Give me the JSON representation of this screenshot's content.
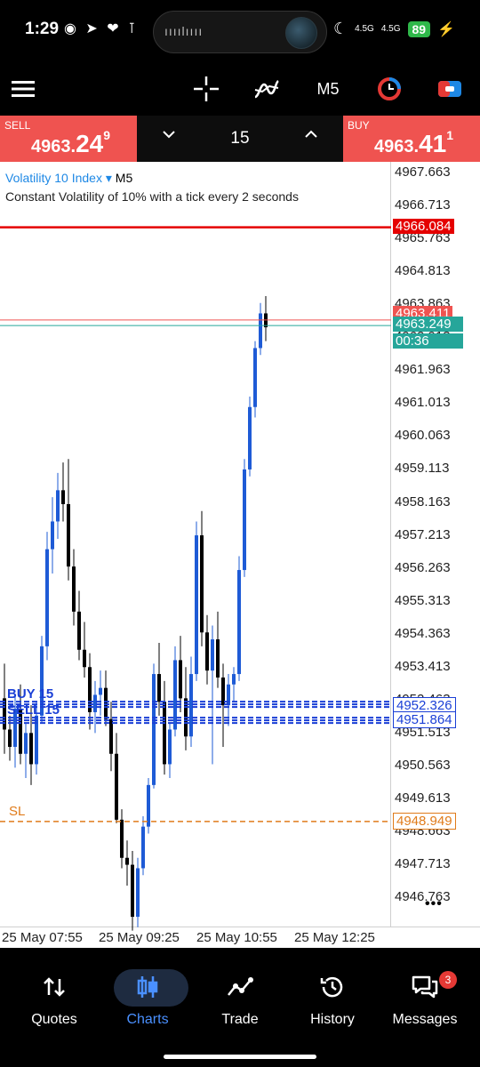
{
  "status_bar": {
    "time": "1:29",
    "left_icons": "◉ ➤ ❤ ⊺",
    "network1": "4.5G",
    "network2": "4.5G",
    "battery": "89",
    "wave": "ıııılıııı"
  },
  "toolbar": {
    "timeframe": "M5"
  },
  "quote": {
    "sell_label": "SELL",
    "sell_price_small": "4963.",
    "sell_price_big": "24",
    "sell_price_sup": "9",
    "buy_label": "BUY",
    "buy_price_small": "4963.",
    "buy_price_big": "41",
    "buy_price_sup": "1",
    "lot": "15"
  },
  "chart": {
    "symbol": "Volatility 10 Index",
    "timeframe": "M5",
    "description": "Constant Volatility of 10% with a tick every 2 seconds",
    "sl_label": "SL",
    "buy_line_label": "BUY 15",
    "sell_line_label": "SELL 15",
    "more": "•••"
  },
  "chart_data": {
    "type": "candlestick",
    "y_ticks": [
      "4967.663",
      "4966.713",
      "4965.763",
      "4964.813",
      "4963.863",
      "4962.913",
      "4961.963",
      "4961.013",
      "4960.063",
      "4959.113",
      "4958.163",
      "4957.213",
      "4956.263",
      "4955.313",
      "4954.363",
      "4953.413",
      "4952.463",
      "4951.513",
      "4950.563",
      "4949.613",
      "4948.663",
      "4947.713",
      "4946.763"
    ],
    "x_ticks": [
      "25 May 07:55",
      "25 May 09:25",
      "25 May 10:55",
      "25 May 12:25"
    ],
    "ylim": [
      4946.2,
      4968.1
    ],
    "price_tags": {
      "alert": "4966.084",
      "ask": "4963.411",
      "bid": "4963.249",
      "countdown": "00:36",
      "buy_position": "4952.326",
      "sell_position": "4951.864",
      "stop_loss": "4948.949"
    },
    "colors": {
      "bull": "#1e5bd6",
      "bear": "#000000",
      "alert": "#e50000",
      "sl": "#e07b1a",
      "position": "#1a3fd6",
      "bid": "#26a69a",
      "ask": "#ef5350"
    },
    "candles": [
      [
        4952.5,
        4953.5,
        4950.9,
        4951.6
      ],
      [
        4951.6,
        4952.0,
        4950.7,
        4951.1
      ],
      [
        4951.1,
        4952.6,
        4950.5,
        4952.2
      ],
      [
        4952.2,
        4952.9,
        4950.6,
        4950.9
      ],
      [
        4950.9,
        4951.8,
        4950.2,
        4951.5
      ],
      [
        4951.5,
        4952.3,
        4950.0,
        4950.6
      ],
      [
        4950.6,
        4952.4,
        4950.3,
        4952.0
      ],
      [
        4952.0,
        4954.3,
        4951.8,
        4954.0
      ],
      [
        4954.0,
        4957.3,
        4953.6,
        4956.8
      ],
      [
        4956.8,
        4958.3,
        4956.1,
        4957.6
      ],
      [
        4957.6,
        4959.0,
        4957.1,
        4958.5
      ],
      [
        4958.5,
        4959.3,
        4957.6,
        4958.1
      ],
      [
        4958.1,
        4959.4,
        4955.9,
        4956.3
      ],
      [
        4956.3,
        4956.8,
        4954.6,
        4955.0
      ],
      [
        4955.0,
        4955.6,
        4953.6,
        4953.9
      ],
      [
        4953.9,
        4954.7,
        4953.1,
        4953.4
      ],
      [
        4953.4,
        4953.8,
        4951.6,
        4952.1
      ],
      [
        4952.1,
        4953.0,
        4951.5,
        4952.6
      ],
      [
        4952.6,
        4953.3,
        4952.0,
        4952.8
      ],
      [
        4952.8,
        4953.3,
        4951.7,
        4951.9
      ],
      [
        4951.9,
        4952.4,
        4950.4,
        4950.9
      ],
      [
        4950.9,
        4951.5,
        4948.9,
        4949.0
      ],
      [
        4949.0,
        4949.3,
        4947.6,
        4947.9
      ],
      [
        4947.9,
        4948.4,
        4947.1,
        4947.7
      ],
      [
        4947.7,
        4948.1,
        4945.8,
        4946.2
      ],
      [
        4946.2,
        4947.9,
        4945.9,
        4947.6
      ],
      [
        4947.6,
        4949.1,
        4947.4,
        4948.8
      ],
      [
        4948.8,
        4950.2,
        4948.6,
        4950.0
      ],
      [
        4950.0,
        4953.5,
        4949.9,
        4953.2
      ],
      [
        4953.2,
        4954.1,
        4952.0,
        4952.4
      ],
      [
        4952.4,
        4953.0,
        4950.3,
        4950.6
      ],
      [
        4950.6,
        4951.8,
        4950.2,
        4951.6
      ],
      [
        4951.6,
        4954.0,
        4951.4,
        4953.6
      ],
      [
        4953.6,
        4954.3,
        4952.1,
        4952.5
      ],
      [
        4952.5,
        4953.4,
        4951.0,
        4951.4
      ],
      [
        4951.4,
        4953.7,
        4951.1,
        4953.2
      ],
      [
        4953.2,
        4957.6,
        4953.0,
        4957.2
      ],
      [
        4957.2,
        4957.9,
        4954.0,
        4954.4
      ],
      [
        4954.4,
        4954.9,
        4952.9,
        4953.3
      ],
      [
        4953.3,
        4954.6,
        4950.6,
        4954.2
      ],
      [
        4954.2,
        4955.0,
        4952.8,
        4953.1
      ],
      [
        4953.1,
        4953.5,
        4951.1,
        4952.3
      ],
      [
        4952.3,
        4953.2,
        4951.7,
        4952.9
      ],
      [
        4952.9,
        4953.4,
        4952.4,
        4953.2
      ],
      [
        4953.2,
        4956.6,
        4953.0,
        4956.2
      ],
      [
        4956.2,
        4959.4,
        4956.0,
        4959.1
      ],
      [
        4959.1,
        4961.2,
        4958.9,
        4960.9
      ],
      [
        4960.9,
        4962.8,
        4960.6,
        4962.6
      ],
      [
        4962.6,
        4963.9,
        4962.4,
        4963.6
      ],
      [
        4963.6,
        4964.1,
        4962.8,
        4963.2
      ]
    ]
  },
  "bottom_nav": {
    "items": [
      {
        "label": "Quotes"
      },
      {
        "label": "Charts"
      },
      {
        "label": "Trade"
      },
      {
        "label": "History"
      },
      {
        "label": "Messages",
        "badge": "3"
      }
    ]
  }
}
